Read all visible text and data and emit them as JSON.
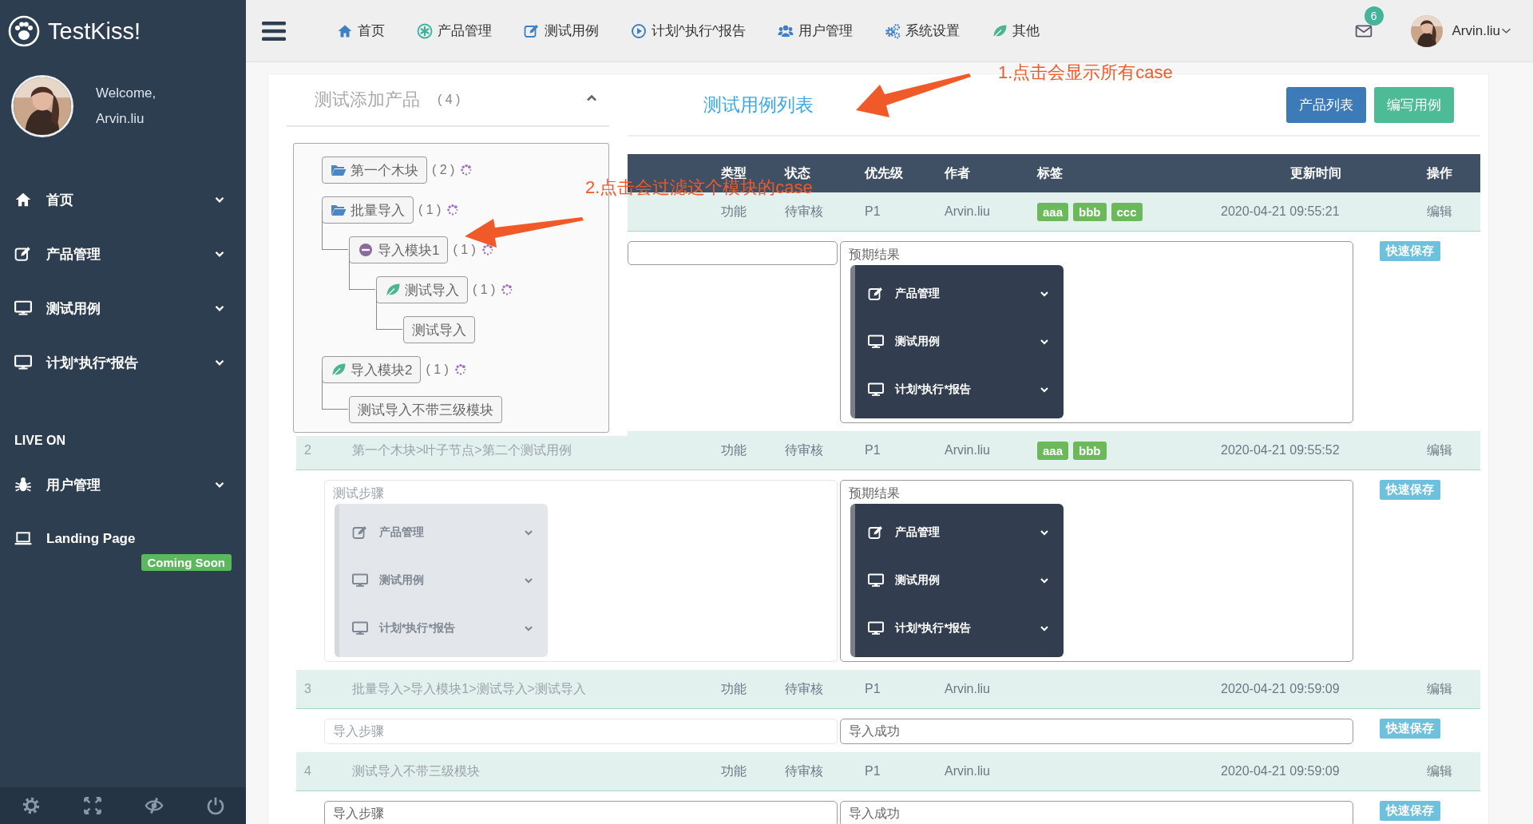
{
  "sidebar": {
    "brand": "TestKiss!",
    "welcome": "Welcome,",
    "user": "Arvin.liu",
    "items": [
      {
        "label": "首页",
        "has_submenu": true
      },
      {
        "label": "产品管理",
        "has_submenu": true
      },
      {
        "label": "测试用例",
        "has_submenu": true
      },
      {
        "label": "计划*执行*报告",
        "has_submenu": true
      }
    ],
    "section": "LIVE ON",
    "section_items": [
      {
        "label": "用户管理",
        "has_submenu": true
      },
      {
        "label": "Landing Page",
        "has_submenu": false,
        "badge": "Coming Soon"
      }
    ]
  },
  "topbar": {
    "nav": [
      "首页",
      "产品管理",
      "测试用例",
      "计划^执行^报告",
      "用户管理",
      "系统设置",
      "其他"
    ],
    "mail_count": "6",
    "user": "Arvin.liu"
  },
  "product_panel": {
    "title": "测试添加产品",
    "count": "( 4 )",
    "tree": [
      {
        "label": "第一个木块",
        "kind": "folder",
        "count": "( 2 )"
      },
      {
        "label": "批量导入",
        "kind": "folder",
        "count": "( 1 )",
        "children": [
          {
            "label": "导入模块1",
            "kind": "collapse",
            "count": "( 1 )",
            "children": [
              {
                "label": "测试导入",
                "kind": "leaf",
                "count": "( 1 )",
                "children": [
                  {
                    "label": "测试导入"
                  }
                ]
              }
            ]
          }
        ]
      },
      {
        "label": "导入模块2",
        "kind": "leaf",
        "count": "( 1 )",
        "children": [
          {
            "label": "测试导入不带三级模块"
          }
        ]
      }
    ]
  },
  "list_title": "测试用例列表",
  "buttons": [
    {
      "label": "产品列表",
      "kind": "primary"
    },
    {
      "label": "编写用例",
      "kind": "success"
    }
  ],
  "annotations": [
    {
      "text": "1.点击会显示所有case"
    },
    {
      "text": "2.点击会过滤这个模块的case"
    }
  ],
  "table": {
    "columns": [
      "类型",
      "状态",
      "优先级",
      "作者",
      "标签",
      "更新时间",
      "操作"
    ],
    "rows": [
      {
        "type": "功能",
        "status": "待审核",
        "priority": "P1",
        "author": "Arvin.liu",
        "tags": [
          "aaa",
          "bbb",
          "ccc"
        ],
        "updated": "2020-04-21 09:55:21",
        "action": "编辑",
        "save": "快速保存",
        "steps": {
          "kind": "input",
          "faded": false
        },
        "expected": {
          "kind": "menu",
          "faded": false,
          "label": "预期结果",
          "menu": [
            "产品管理",
            "测试用例",
            "计划*执行*报告"
          ]
        }
      },
      {
        "faded": true,
        "id": "2",
        "name": "第一个木块>叶子节点>第二个测试用例",
        "type": "功能",
        "status": "待审核",
        "priority": "P1",
        "author": "Arvin.liu",
        "tags": [
          "aaa",
          "bbb"
        ],
        "updated": "2020-04-21 09:55:52",
        "action": "编辑",
        "save": "快速保存",
        "steps": {
          "kind": "menu",
          "faded": true,
          "label": "测试步骤",
          "menu": [
            "产品管理",
            "测试用例",
            "计划*执行*报告"
          ]
        },
        "expected": {
          "kind": "menu",
          "faded": false,
          "label": "预期结果",
          "menu": [
            "产品管理",
            "测试用例",
            "计划*执行*报告"
          ]
        }
      },
      {
        "faded": true,
        "id": "3",
        "name": "批量导入>导入模块1>测试导入>测试导入",
        "type": "功能",
        "status": "待审核",
        "priority": "P1",
        "author": "Arvin.liu",
        "updated": "2020-04-21 09:59:09",
        "action": "编辑",
        "save": "快速保存",
        "steps": {
          "kind": "text",
          "faded": true,
          "value": "导入步骤"
        },
        "expected": {
          "kind": "text",
          "faded": false,
          "value": "导入成功"
        }
      },
      {
        "faded": true,
        "id": "4",
        "name": "测试导入不带三级模块",
        "type": "功能",
        "status": "待审核",
        "priority": "P1",
        "author": "Arvin.liu",
        "updated": "2020-04-21 09:59:09",
        "action": "编辑",
        "save": "快速保存",
        "steps": {
          "kind": "text",
          "faded": false,
          "value": "导入步骤"
        },
        "expected": {
          "kind": "text",
          "faded": false,
          "value": "导入成功"
        }
      }
    ]
  }
}
